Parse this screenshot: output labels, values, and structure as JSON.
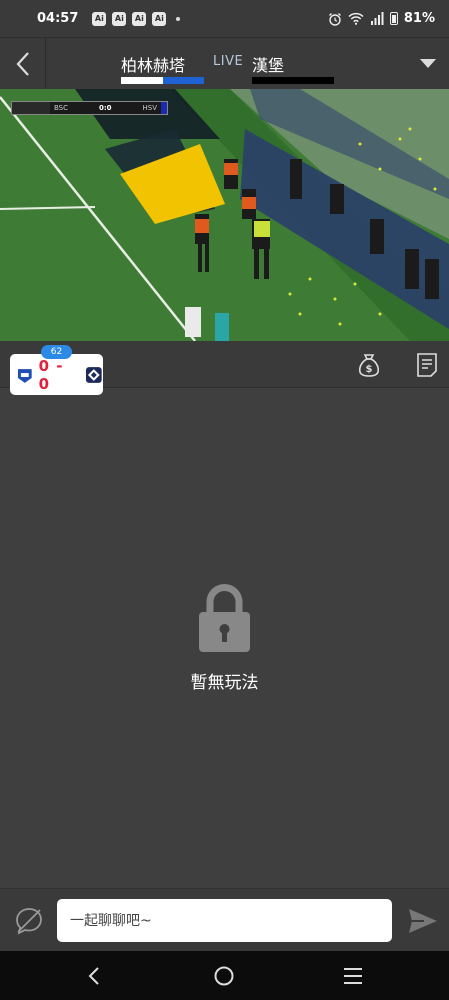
{
  "status_bar": {
    "time": "04:57",
    "notification_badges": [
      "Ai",
      "Ai",
      "Ai",
      "Ai"
    ],
    "battery": "81%"
  },
  "header": {
    "home_team": "柏林赫塔",
    "live_label": "LIVE",
    "away_team": "漢堡"
  },
  "video": {
    "scoreboard_home": "BSC",
    "scoreboard_score": "0:0",
    "scoreboard_away": "HSV"
  },
  "match": {
    "minute": "62",
    "score": "0 - 0"
  },
  "main": {
    "empty_message": "暫無玩法"
  },
  "chat": {
    "placeholder": "一起聊聊吧~"
  },
  "colors": {
    "accent_blue": "#2b8ae6",
    "score_red": "#e4213a",
    "home_kit_blue": "#1f62d3",
    "away_kit": "#000000"
  }
}
